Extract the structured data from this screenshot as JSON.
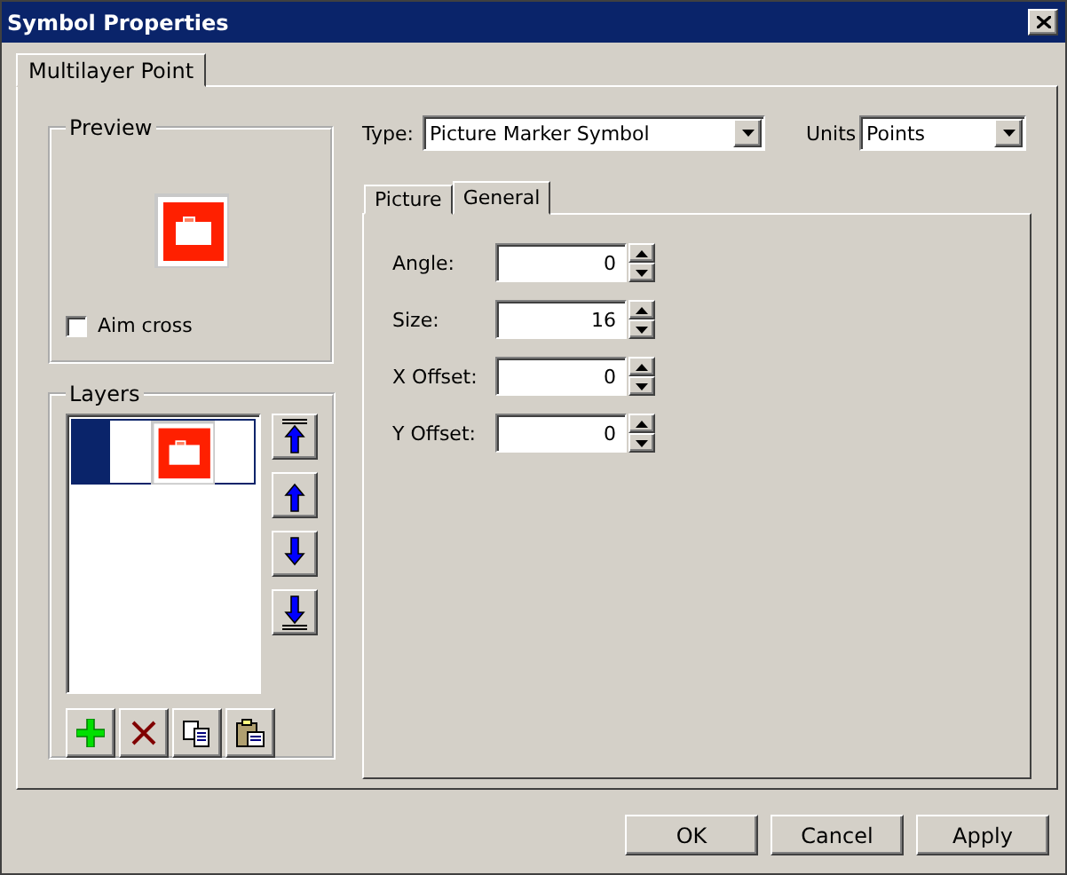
{
  "window": {
    "title": "Symbol Properties"
  },
  "outer_tabs": [
    {
      "label": "Multilayer Point",
      "selected": true
    }
  ],
  "preview": {
    "title": "Preview",
    "aim_cross": {
      "label": "Aim cross",
      "checked": false
    }
  },
  "type": {
    "label": "Type:",
    "value": "Picture Marker Symbol"
  },
  "units": {
    "label": "Units",
    "value": "Points"
  },
  "tabs": [
    {
      "label": "Picture",
      "selected": false
    },
    {
      "label": "General",
      "selected": true
    }
  ],
  "fields": [
    {
      "label": "Angle:",
      "value": "0"
    },
    {
      "label": "Size:",
      "value": "16"
    },
    {
      "label": "X Offset:",
      "value": "0"
    },
    {
      "label": "Y Offset:",
      "value": "0"
    }
  ],
  "layers": {
    "title": "Layers",
    "items": [
      {
        "selected": true
      }
    ]
  },
  "buttons": [
    "OK",
    "Cancel",
    "Apply"
  ]
}
